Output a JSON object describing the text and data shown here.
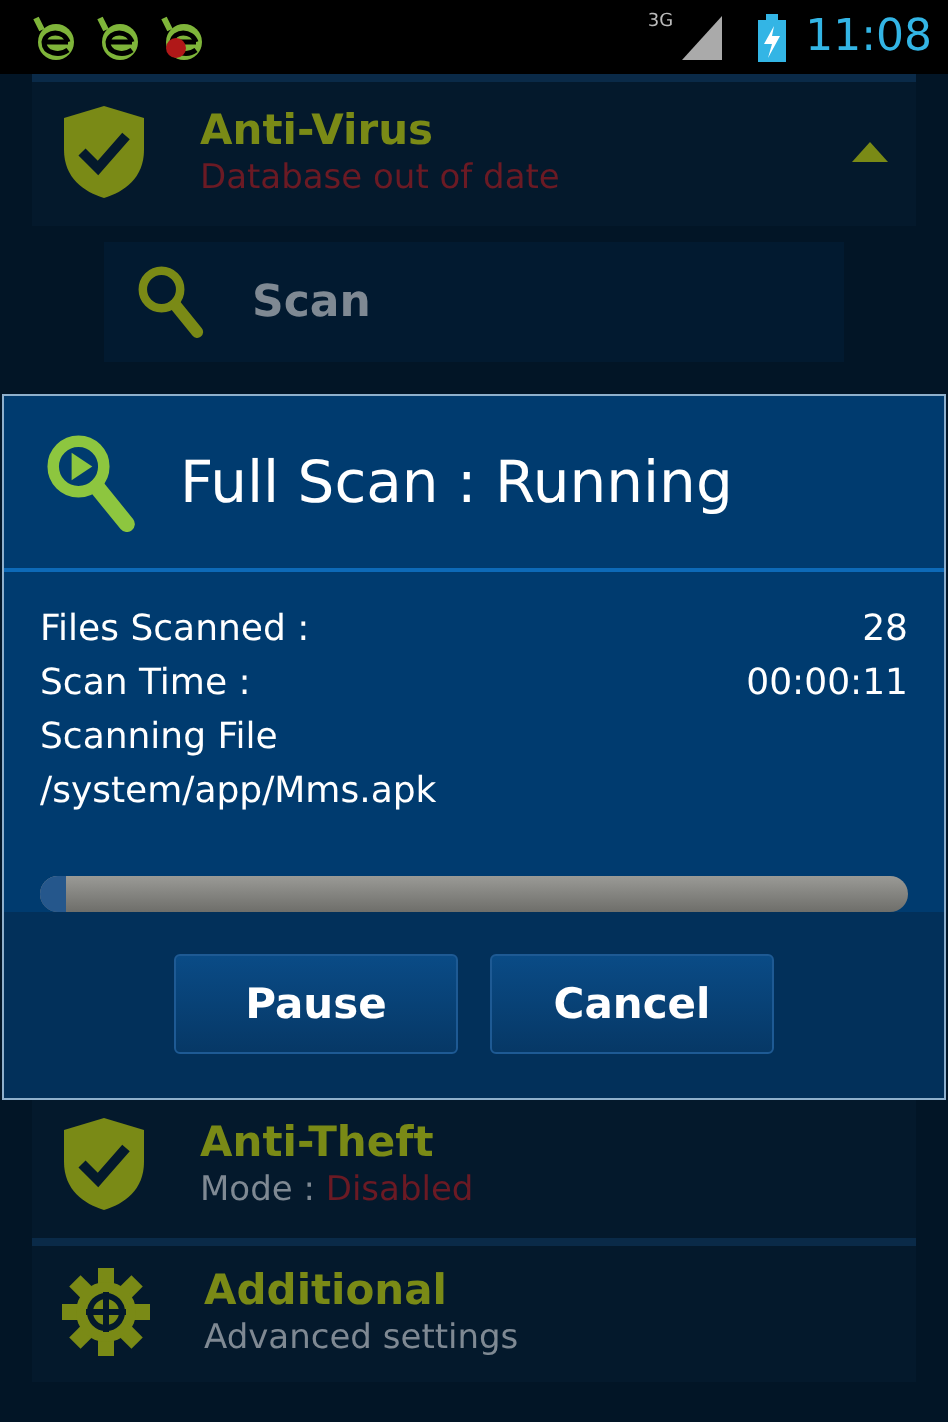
{
  "status_bar": {
    "notifications": [
      {
        "kind": "app"
      },
      {
        "kind": "app"
      },
      {
        "kind": "app-alert"
      }
    ],
    "network": "3G",
    "time": "11:08"
  },
  "modules": [
    {
      "kind": "shield",
      "title": "Anti-Virus",
      "status": "Database out of date",
      "expanded": true
    },
    {
      "kind": "shield",
      "title": "Anti-Theft",
      "status_label": "Mode : ",
      "status": "Disabled",
      "expanded": false
    },
    {
      "kind": "gear",
      "title": "Additional",
      "subtitle": "Advanced settings",
      "expanded": false
    }
  ],
  "sub_items": [
    {
      "label": "Scan"
    }
  ],
  "dialog": {
    "title": "Full Scan : Running",
    "stats": [
      {
        "label": "Files Scanned :",
        "value": "28"
      },
      {
        "label": "Scan Time :",
        "value": "00:00:11"
      }
    ],
    "current_label": "Scanning File",
    "current_file": "/system/app/Mms.apk",
    "progress": {
      "level": 0.03
    },
    "buttons": [
      "Pause",
      "Cancel"
    ]
  }
}
